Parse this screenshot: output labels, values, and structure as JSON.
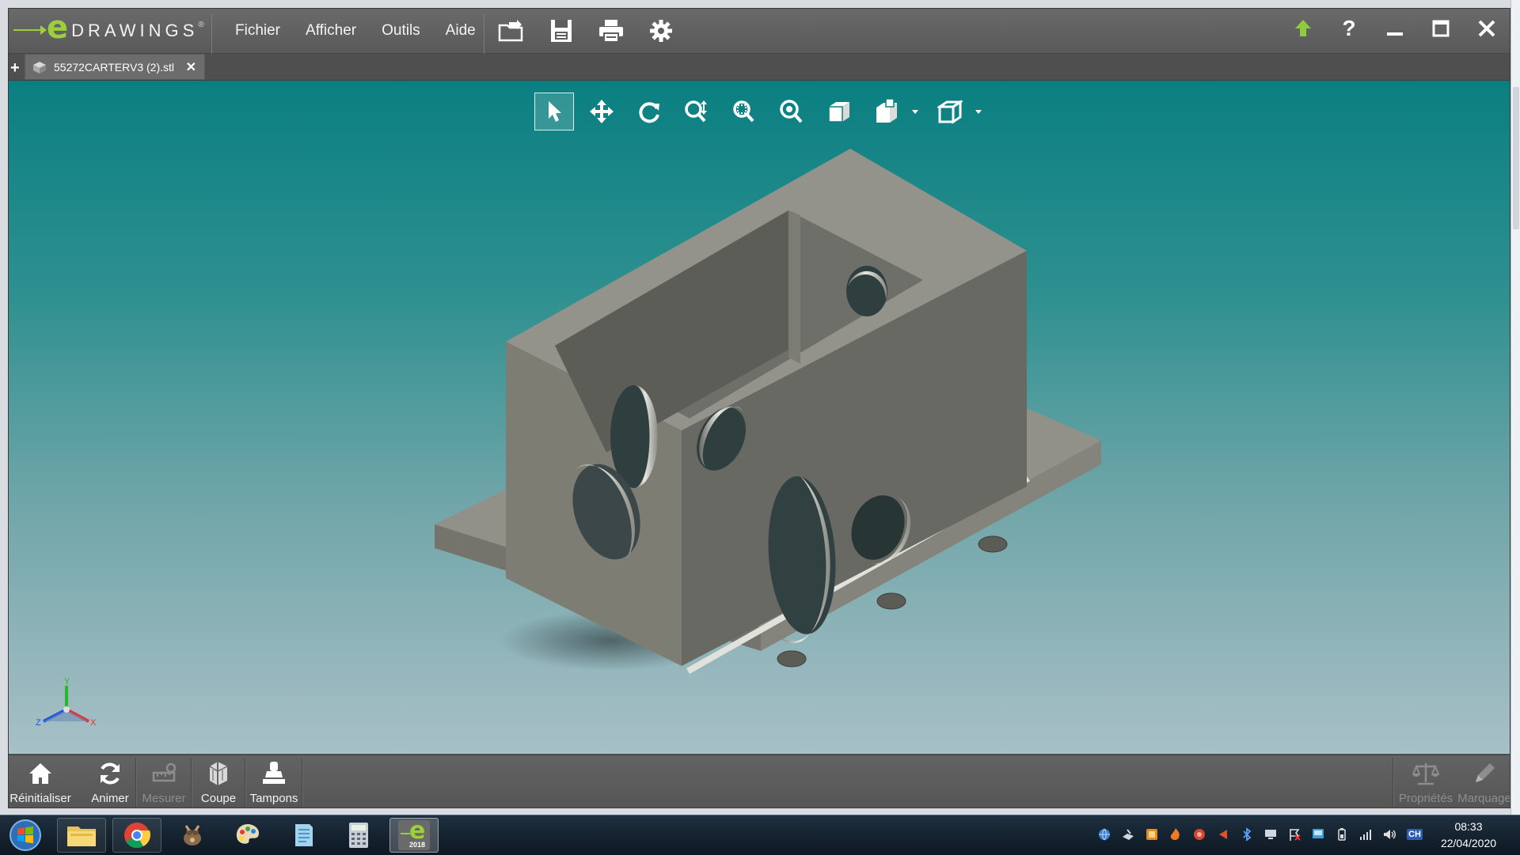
{
  "app": {
    "logo_letter": "e",
    "logo_text": "DRAWINGS",
    "logo_mark": "®"
  },
  "menu": [
    {
      "label": "Fichier"
    },
    {
      "label": "Afficher"
    },
    {
      "label": "Outils"
    },
    {
      "label": "Aide"
    }
  ],
  "toolbar_icons": [
    "open-folder-icon",
    "save-icon",
    "print-icon",
    "settings-gear-icon"
  ],
  "window_controls": [
    "upgrade-arrow-icon",
    "help-icon",
    "minimize-icon",
    "maximize-icon",
    "close-icon"
  ],
  "help_label": "?",
  "tabs": {
    "add_label": "+",
    "doc_label": "55272CARTERV3 (2).stl",
    "close_label": "✕"
  },
  "view_tools": [
    "select-arrow-icon",
    "pan-move-icon",
    "rotate-icon",
    "zoom-icon",
    "zoom-to-area-icon",
    "zoom-to-fit-icon",
    "shaded-cube-icon",
    "standard-views-icon",
    "view-mode-cube-icon"
  ],
  "triad": {
    "x": "X",
    "y": "Y",
    "z": "Z"
  },
  "bottom_tools": {
    "reset": "Réinitialiser",
    "animate": "Animer",
    "measure": "Mesurer",
    "section": "Coupe",
    "stamps": "Tampons",
    "properties": "Propriétés",
    "markup": "Marquage"
  },
  "taskbar": {
    "apps": [
      "windows-explorer-icon",
      "chrome-icon",
      "gimp-icon",
      "paint-palette-icon",
      "notepad-icon",
      "calculator-icon",
      "edrawings-icon"
    ],
    "edrawings_badge": "2018",
    "clock_time": "08:33",
    "clock_date": "22/04/2020",
    "tray_lang": "CH"
  },
  "colors": {
    "title_bg": "#5a5a5a",
    "accent_green": "#9ccf3a",
    "viewport_top": "#0a7f81",
    "viewport_bottom": "#a8c0c7",
    "part_gray": "#7a7a72"
  }
}
